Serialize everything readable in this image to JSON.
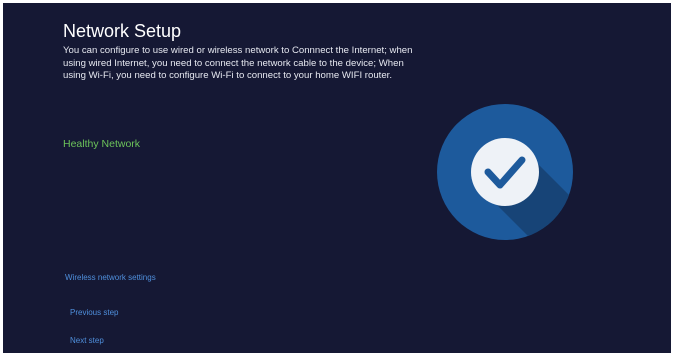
{
  "page": {
    "title": "Network Setup",
    "description": "You can configure to use wired or wireless network to Connnect the Internet; when using wired Internet, you need to connect the network cable to the device; When using Wi-Fi, you need to configure Wi-Fi to connect to your home WIFI router.",
    "status": "Healthy Network"
  },
  "actions": {
    "wireless_settings": "Wireless network settings",
    "previous": "Previous step",
    "next": "Next step"
  },
  "status_icon": {
    "name": "check-circle-icon",
    "colors": {
      "circle": "#1d5a9c",
      "shadow": "#174477",
      "inner": "#eef2f7",
      "check": "#1d5a9c"
    }
  },
  "colors": {
    "background": "#151834",
    "status_text": "#6cc35a",
    "link_text": "#4f8fdc"
  }
}
